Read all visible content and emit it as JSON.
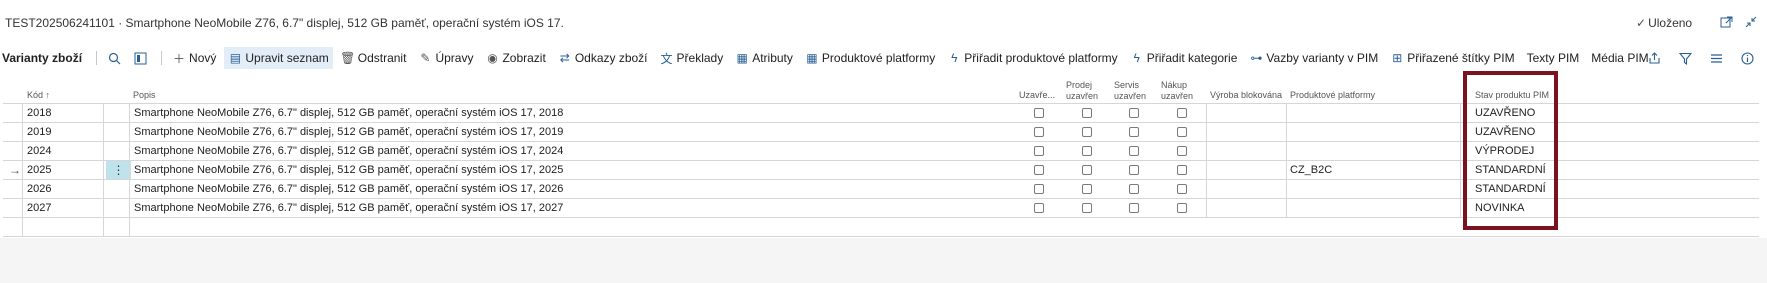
{
  "header": {
    "title": "TEST202506241101 · Smartphone NeoMobile Z76, 6.7\" displej, 512 GB paměť, operační systém iOS 17.",
    "saved_label": "Uloženo",
    "icons": [
      "checkmark-icon",
      "open-new-window-icon",
      "collapse-icon"
    ]
  },
  "actionbar": {
    "title": "Varianty zboží",
    "buttons": [
      {
        "label": "Nový",
        "icon": "plus-icon"
      },
      {
        "label": "Upravit seznam",
        "icon": "edit-list-icon"
      },
      {
        "label": "Odstranit",
        "icon": "trash-icon"
      },
      {
        "label": "Úpravy",
        "icon": "pencil-icon"
      },
      {
        "label": "Zobrazit",
        "icon": "eye-icon"
      },
      {
        "label": "Odkazy zboží",
        "icon": "link-icon"
      },
      {
        "label": "Překlady",
        "icon": "translate-icon"
      },
      {
        "label": "Atributy",
        "icon": "grid-icon"
      },
      {
        "label": "Produktové platformy",
        "icon": "grid-icon"
      },
      {
        "label": "Přiřadit produktové platformy",
        "icon": "assign-icon"
      },
      {
        "label": "Přiřadit kategorie",
        "icon": "assign-icon"
      },
      {
        "label": "Vazby varianty v PIM",
        "icon": "relation-icon"
      },
      {
        "label": "Přiřazené štítky PIM",
        "icon": "tag-icon"
      },
      {
        "label": "Texty PIM",
        "icon": ""
      },
      {
        "label": "Média PIM",
        "icon": ""
      }
    ]
  },
  "grid": {
    "columns": {
      "kod": "Kód ↑",
      "popis": "Popis",
      "uzavreno": "Uzavře...",
      "prodej": "Prodej uzavřen",
      "servis": "Servis uzavřen",
      "nakup": "Nákup uzavřen",
      "vyroba": "Výroba blokována",
      "platformy": "Produktové platformy",
      "stav": "Stav produktu PIM"
    },
    "rows": [
      {
        "kod": "2018",
        "popis": "Smartphone NeoMobile Z76, 6.7\" displej, 512 GB paměť, operační systém iOS 17, 2018",
        "platformy": "",
        "stav": "UZAVŘENO"
      },
      {
        "kod": "2019",
        "popis": "Smartphone NeoMobile Z76, 6.7\" displej, 512 GB paměť, operační systém iOS 17, 2019",
        "platformy": "",
        "stav": "UZAVŘENO"
      },
      {
        "kod": "2024",
        "popis": "Smartphone NeoMobile Z76, 6.7\" displej, 512 GB paměť, operační systém iOS 17, 2024",
        "platformy": "",
        "stav": "VÝPRODEJ"
      },
      {
        "kod": "2025",
        "popis": "Smartphone NeoMobile Z76, 6.7\" displej, 512 GB paměť, operační systém iOS 17, 2025",
        "platformy": "CZ_B2C",
        "stav": "STANDARDNÍ",
        "current": true
      },
      {
        "kod": "2026",
        "popis": "Smartphone NeoMobile Z76, 6.7\" displej, 512 GB paměť, operační systém iOS 17, 2026",
        "platformy": "",
        "stav": "STANDARDNÍ"
      },
      {
        "kod": "2027",
        "popis": "Smartphone NeoMobile Z76, 6.7\" displej, 512 GB paměť, operační systém iOS 17, 2027",
        "platformy": "",
        "stav": "NOVINKA"
      }
    ],
    "row_arrow": "→",
    "row_menu": "⋮"
  },
  "colors": {
    "accent": "#2a5f94",
    "active_button_bg": "#e3edf8",
    "selected_cell_bg": "#bfe3ec",
    "highlight_border": "#7b1220"
  }
}
